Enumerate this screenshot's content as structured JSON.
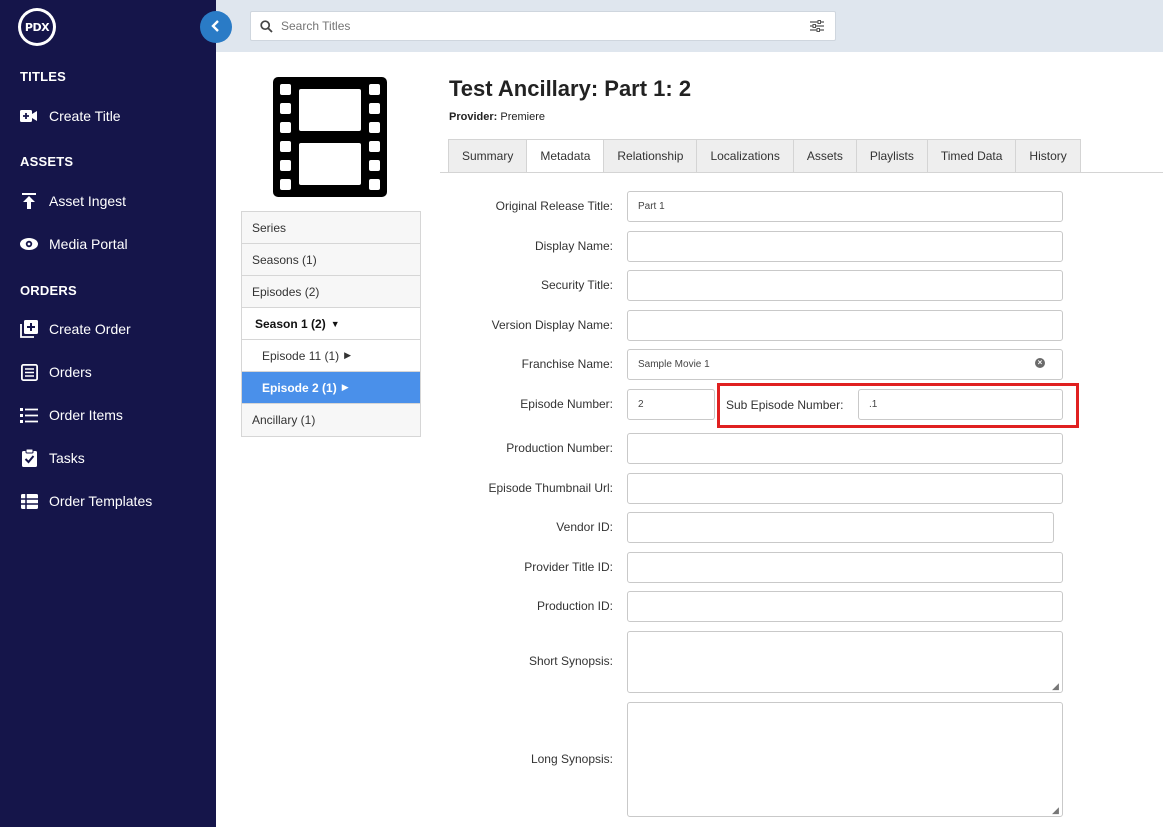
{
  "sidebar": {
    "logo_text": "PDX",
    "sections": {
      "titles": "TITLES",
      "assets": "ASSETS",
      "orders": "ORDERS"
    },
    "items": {
      "create_title": "Create Title",
      "asset_ingest": "Asset Ingest",
      "media_portal": "Media Portal",
      "create_order": "Create Order",
      "orders": "Orders",
      "order_items": "Order Items",
      "tasks": "Tasks",
      "order_templates": "Order Templates"
    }
  },
  "search": {
    "placeholder": "Search Titles"
  },
  "tree": {
    "series": "Series",
    "seasons": "Seasons (1)",
    "episodes": "Episodes (2)",
    "season1": "Season 1 (2)",
    "episode11": "Episode 11 (1)",
    "episode2": "Episode 2 (1)",
    "ancillary": "Ancillary (1)"
  },
  "title": "Test Ancillary: Part 1: 2",
  "provider": {
    "label": "Provider:",
    "value": "Premiere"
  },
  "tabs": {
    "summary": "Summary",
    "metadata": "Metadata",
    "relationship": "Relationship",
    "localizations": "Localizations",
    "assets": "Assets",
    "playlists": "Playlists",
    "timed_data": "Timed Data",
    "history": "History"
  },
  "form": {
    "original_release_title": {
      "label": "Original Release Title:",
      "value": "Part 1"
    },
    "display_name": {
      "label": "Display Name:",
      "value": ""
    },
    "security_title": {
      "label": "Security Title:",
      "value": ""
    },
    "version_display_name": {
      "label": "Version Display Name:",
      "value": ""
    },
    "franchise_name": {
      "label": "Franchise Name:",
      "value": "Sample Movie 1"
    },
    "episode_number": {
      "label": "Episode Number:",
      "value": "2"
    },
    "sub_episode_number": {
      "label": "Sub Episode Number:",
      "value": ".1"
    },
    "production_number": {
      "label": "Production Number:",
      "value": ""
    },
    "episode_thumbnail_url": {
      "label": "Episode Thumbnail Url:",
      "value": ""
    },
    "vendor_id": {
      "label": "Vendor ID:",
      "value": ""
    },
    "provider_title_id": {
      "label": "Provider Title ID:",
      "value": ""
    },
    "production_id": {
      "label": "Production ID:",
      "value": ""
    },
    "short_synopsis": {
      "label": "Short Synopsis:",
      "value": ""
    },
    "long_synopsis": {
      "label": "Long Synopsis:",
      "value": ""
    }
  },
  "colors": {
    "sidebar_bg": "#15154a",
    "accent": "#2a7bc6",
    "active_tree": "#4a90ea",
    "highlight": "#e02020"
  }
}
